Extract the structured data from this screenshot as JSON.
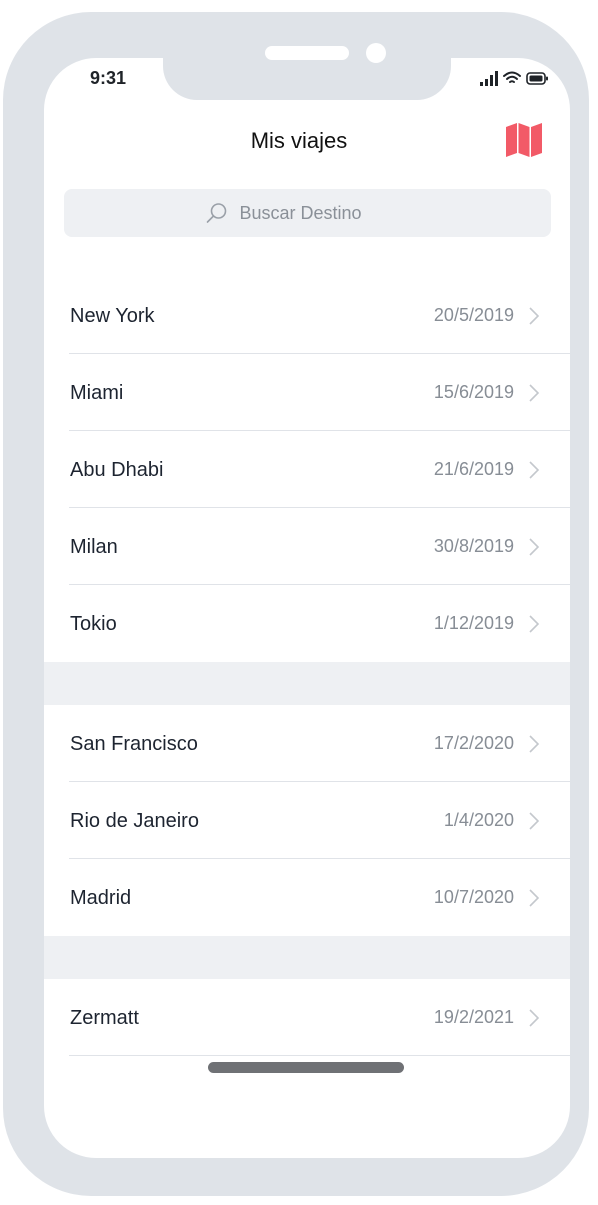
{
  "status_bar": {
    "time": "9:31"
  },
  "header": {
    "title": "Mis viajes"
  },
  "search": {
    "placeholder": "Buscar Destino"
  },
  "trip_groups": [
    [
      {
        "name": "New York",
        "date": "20/5/2019"
      },
      {
        "name": "Miami",
        "date": "15/6/2019"
      },
      {
        "name": "Abu Dhabi",
        "date": "21/6/2019"
      },
      {
        "name": "Milan",
        "date": "30/8/2019"
      },
      {
        "name": "Tokio",
        "date": "1/12/2019"
      }
    ],
    [
      {
        "name": "San Francisco",
        "date": "17/2/2020"
      },
      {
        "name": "Rio de Janeiro",
        "date": "1/4/2020"
      },
      {
        "name": "Madrid",
        "date": "10/7/2020"
      }
    ],
    [
      {
        "name": "Zermatt",
        "date": "19/2/2021"
      }
    ]
  ],
  "colors": {
    "accent": "#f25a67",
    "frame": "#dfe3e8",
    "section_gap": "#eef0f3",
    "date_text": "#878d95"
  },
  "icons": {
    "map": "map-icon",
    "search": "search-icon",
    "chevron": "chevron-right-icon"
  }
}
